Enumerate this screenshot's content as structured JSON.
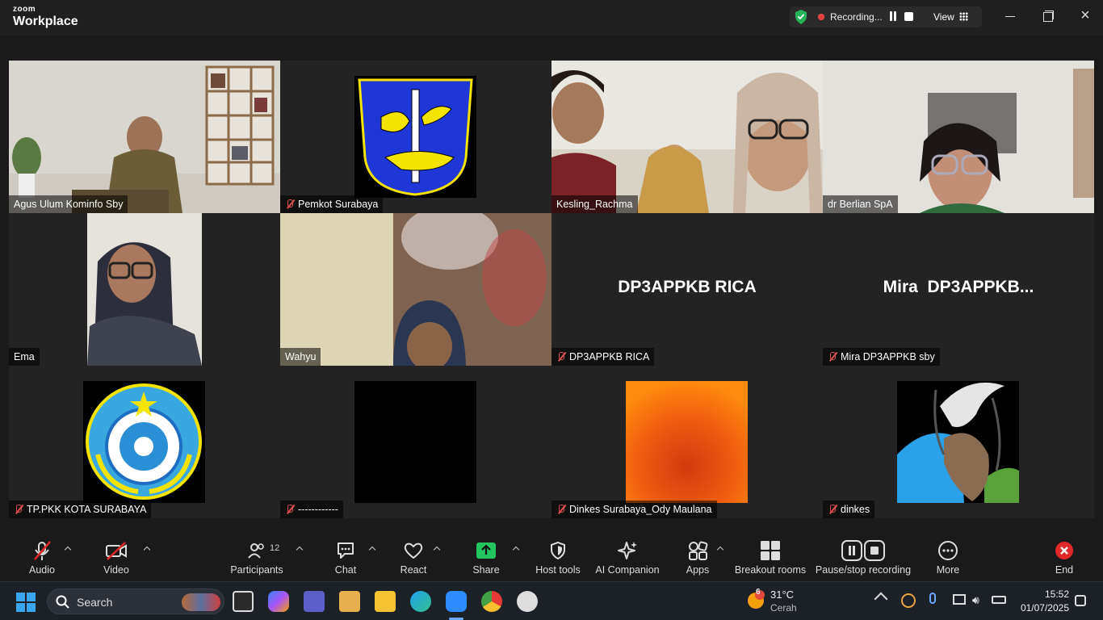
{
  "app": {
    "brand_small": "zoom",
    "brand_big": "Workplace"
  },
  "recording": {
    "status": "Recording...",
    "view_label": "View"
  },
  "tiles": [
    {
      "name": "Agus Ulum Kominfo Sby",
      "muted": false
    },
    {
      "name": "Pemkot Surabaya",
      "muted": true
    },
    {
      "name": "Kesling_Rachma",
      "muted": false
    },
    {
      "name": "dr Berlian SpA",
      "muted": false
    },
    {
      "name": "Ema",
      "muted": false
    },
    {
      "name": "Wahyu",
      "muted": false
    },
    {
      "name": "DP3APPKB RICA",
      "muted": true,
      "display": "DP3APPKB RICA"
    },
    {
      "name": "Mira DP3APPKB sby",
      "muted": true,
      "display": "Mira  DP3APPKB..."
    },
    {
      "name": "TP.PKK KOTA SURABAYA",
      "muted": true
    },
    {
      "name": "------------",
      "muted": true
    },
    {
      "name": "Dinkes Surabaya_Ody Maulana",
      "muted": true
    },
    {
      "name": "dinkes",
      "muted": true
    }
  ],
  "toolbar": {
    "audio": "Audio",
    "video": "Video",
    "participants": "Participants",
    "participants_count": "12",
    "chat": "Chat",
    "react": "React",
    "share": "Share",
    "host_tools": "Host tools",
    "ai_companion": "AI Companion",
    "apps": "Apps",
    "breakout": "Breakout rooms",
    "pause_stop": "Pause/stop recording",
    "more": "More",
    "end": "End"
  },
  "taskbar": {
    "search_placeholder": "Search",
    "weather_temp": "31°C",
    "weather_desc": "Cerah",
    "weather_badge": "6",
    "time": "15:52",
    "date": "01/07/2025"
  },
  "colors": {
    "active_speaker": "#3cdc86",
    "share_green": "#22c55e",
    "end_red": "#e02828",
    "muted_red": "#e05050"
  }
}
